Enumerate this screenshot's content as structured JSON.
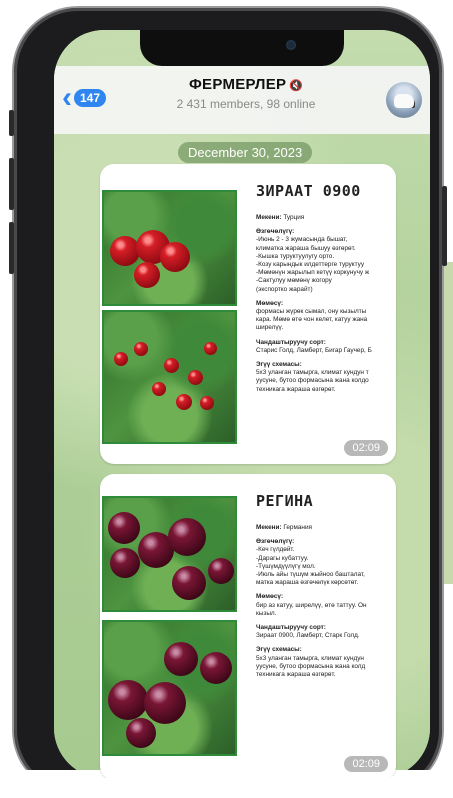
{
  "header": {
    "back_count": "147",
    "title": "ФЕРМЕРЛЕР",
    "mute_icon": "🔇",
    "subtitle": "2 431 members, 98 online"
  },
  "date": "December 30, 2023",
  "cards": [
    {
      "name": "ЗИРААТ 0900",
      "lines": [
        {
          "label": "Мекени:",
          "text": " Турция"
        },
        {
          "label": "Өзгөчөлүгү:",
          "text": ""
        },
        {
          "label": "",
          "text": "-Июнь 2 - 3 жумасында бышат,"
        },
        {
          "label": "",
          "text": " климатка жараша бышуу өзгөрөт."
        },
        {
          "label": "",
          "text": "-Кышка туруктуулугу орто."
        },
        {
          "label": "",
          "text": "-Козу карындык илдеттерге туруктуу"
        },
        {
          "label": "",
          "text": "-Мөмөнүн жарылып кетүү коркунучу ж"
        },
        {
          "label": "",
          "text": "-Сактулуу мөмөнү жогору"
        },
        {
          "label": "",
          "text": " (экспортко жарайт)"
        },
        {
          "label": "Мөмөсү:",
          "text": ""
        },
        {
          "label": "",
          "text": "формасы жүрөк сымал, ону кызылты"
        },
        {
          "label": "",
          "text": "кара. Мөмө өтө чон келет, катуу жана"
        },
        {
          "label": "",
          "text": "ширелүү."
        },
        {
          "label": "Чандаштыруучу сорт:",
          "text": ""
        },
        {
          "label": "",
          "text": "Старис Голд, Ламберт, Бигар Гаучер, Б"
        },
        {
          "label": "Эгүү схемасы:",
          "text": ""
        },
        {
          "label": "",
          "text": "5х3 уланган тамырга, климат кундун т"
        },
        {
          "label": "",
          "text": "уусуне, бутоо формасына  жана колдо"
        },
        {
          "label": "",
          "text": "техникага жараша өзгөрөт."
        }
      ],
      "time": "02:09"
    },
    {
      "name": "РЕГИНА",
      "lines": [
        {
          "label": "Мекени:",
          "text": " Германия"
        },
        {
          "label": "Өзгөчөлүгү:",
          "text": ""
        },
        {
          "label": "",
          "text": "-Кеч гүлдөйт."
        },
        {
          "label": "",
          "text": "-Дарагы кубаттуу."
        },
        {
          "label": "",
          "text": "-Түшүмдүүлүгү мол."
        },
        {
          "label": "",
          "text": "-Июль айы түшүм жыйноо башталат,"
        },
        {
          "label": "",
          "text": "матка жараша өзгөчөлүк көрсөтөт."
        },
        {
          "label": "Мөмөсү:",
          "text": ""
        },
        {
          "label": "",
          "text": "бир аз катуу, ширелүү, өтө таттуу. Он"
        },
        {
          "label": "",
          "text": "кызыл."
        },
        {
          "label": "Чандаштыруучу сорт:",
          "text": ""
        },
        {
          "label": "",
          "text": "Зираат 0900, Ламберт, Старк Голд."
        },
        {
          "label": "Эгүү схемасы:",
          "text": ""
        },
        {
          "label": "",
          "text": "5х3 уланган тамырга, климат кундун"
        },
        {
          "label": "",
          "text": "уусуне, бутоо формасына  жана колд"
        },
        {
          "label": "",
          "text": "техникага жараша өзгөрөт."
        }
      ],
      "time": "02:09"
    }
  ]
}
